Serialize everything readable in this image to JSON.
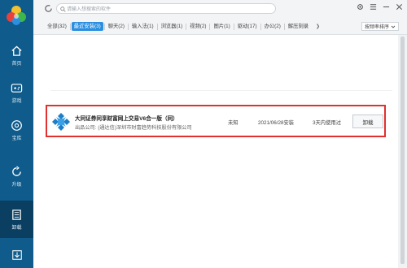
{
  "sidebar": {
    "items": [
      {
        "label": "首页",
        "icon": "home-icon"
      },
      {
        "label": "游戏",
        "icon": "gamepad-icon"
      },
      {
        "label": "宝库",
        "icon": "disc-icon"
      },
      {
        "label": "升级",
        "icon": "upgrade-icon"
      },
      {
        "label": "卸载",
        "icon": "trash-icon"
      }
    ],
    "active_index": 4,
    "bottom_icon": "download-icon",
    "colors": {
      "bg": "#0f5b8b",
      "active": "#0a3f62"
    }
  },
  "search": {
    "placeholder": "请输入想搜索的软件"
  },
  "window_buttons": [
    "settings-icon",
    "menu-icon",
    "minimize-icon",
    "close-icon"
  ],
  "tabs": [
    {
      "label": "全部(32)",
      "active": false
    },
    {
      "label": "最近安装(3)",
      "active": true
    },
    {
      "label": "聊天(2)",
      "active": false
    },
    {
      "label": "输入法(1)",
      "active": false
    },
    {
      "label": "浏览器(1)",
      "active": false
    },
    {
      "label": "视频(2)",
      "active": false
    },
    {
      "label": "图片(1)",
      "active": false
    },
    {
      "label": "驱动(17)",
      "active": false
    },
    {
      "label": "办公(2)",
      "active": false
    },
    {
      "label": "解压刻录",
      "active": false
    }
  ],
  "sort_button": {
    "label": "按频率排序"
  },
  "app_row": {
    "name": "大同证券同享财富网上交易V6合一版（同）",
    "publisher": "出品公司: (通达信)深圳市财富趋势科技股份有限公司",
    "status": "未知",
    "install_date": "2021/06/28安装",
    "usage": "3天内使用过",
    "uninstall_label": "卸载"
  },
  "colors": {
    "accent": "#2b8ee0",
    "highlight_border": "#e0312e"
  }
}
